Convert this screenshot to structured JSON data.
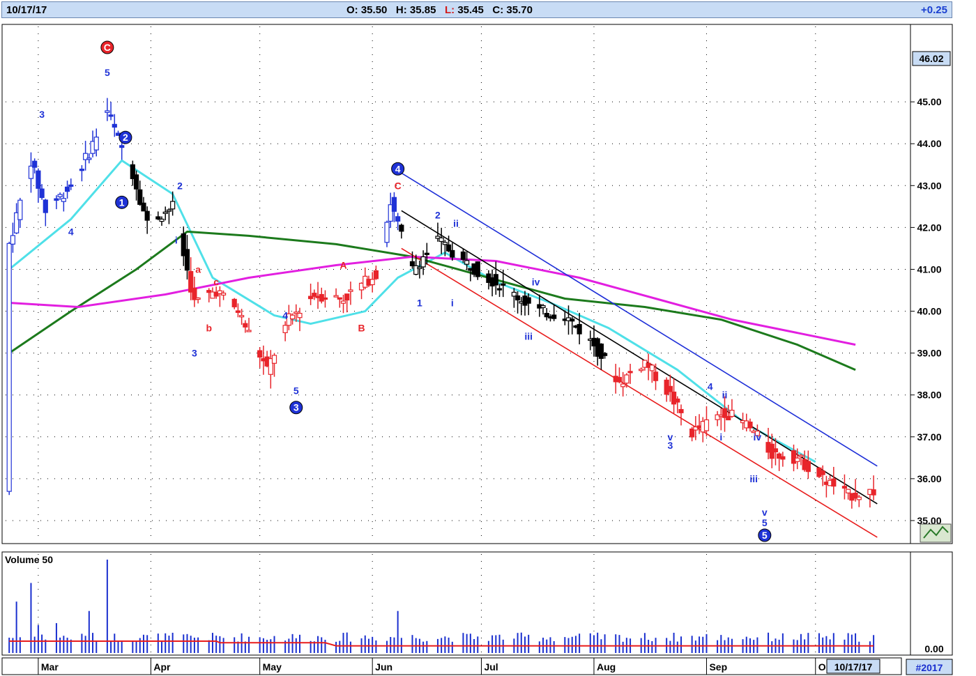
{
  "header": {
    "date": "10/17/17",
    "open_label": "O:",
    "open": "35.50",
    "high_label": "H:",
    "high": "35.85",
    "low_label": "L:",
    "low": "35.45",
    "close_label": "C:",
    "close": "35.70",
    "change": "+0.25"
  },
  "price_axis": {
    "last_price_box": "46.02",
    "ticks": [
      "45.00",
      "44.00",
      "43.00",
      "42.00",
      "41.00",
      "40.00",
      "39.00",
      "38.00",
      "37.00",
      "36.00",
      "35.00"
    ]
  },
  "volume_panel": {
    "title": "Volume 50",
    "tick": "0.00"
  },
  "time_axis": {
    "months": [
      "Mar",
      "Apr",
      "May",
      "Jun",
      "Jul",
      "Aug",
      "Sep",
      "O"
    ],
    "current_date_box": "10/17/17",
    "badge": "#2017"
  },
  "colors": {
    "up_wave": "#1f32d6",
    "down_wave": "#e8242a",
    "neutral": "#000000",
    "ma_short": "#4fe0e8",
    "ma_mid": "#1c7a1c",
    "ma_long": "#e21fe0",
    "channel_upper": "#1e2fd8",
    "channel_mid": "#000000",
    "channel_lower": "#e81c1c"
  },
  "chart_data": {
    "type": "candlestick",
    "title": "",
    "ylim": [
      34.5,
      46.8
    ],
    "months": [
      "Mar",
      "Apr",
      "May",
      "Jun",
      "Jul",
      "Aug",
      "Sep",
      "O"
    ],
    "price_path": [
      [
        "2017-02-21",
        41.6
      ],
      [
        "2017-02-27",
        43.6
      ],
      [
        "2017-03-03",
        42.4
      ],
      [
        "2017-03-10",
        43.0
      ],
      [
        "2017-03-15",
        43.8
      ],
      [
        "2017-03-20",
        44.8
      ],
      [
        "2017-03-23",
        44.1
      ],
      [
        "2017-03-27",
        43.3
      ],
      [
        "2017-03-31",
        42.1
      ],
      [
        "2017-04-07",
        42.5
      ],
      [
        "2017-04-13",
        40.2
      ],
      [
        "2017-04-19",
        40.5
      ],
      [
        "2017-04-25",
        40.0
      ],
      [
        "2017-05-03",
        38.6
      ],
      [
        "2017-05-09",
        39.8
      ],
      [
        "2017-05-16",
        40.4
      ],
      [
        "2017-05-24",
        40.3
      ],
      [
        "2017-06-02",
        40.9
      ],
      [
        "2017-06-06",
        42.6
      ],
      [
        "2017-06-12",
        41.0
      ],
      [
        "2017-06-19",
        41.7
      ],
      [
        "2017-06-26",
        41.2
      ],
      [
        "2017-07-03",
        40.8
      ],
      [
        "2017-07-10",
        40.4
      ],
      [
        "2017-07-17",
        40.0
      ],
      [
        "2017-07-24",
        39.9
      ],
      [
        "2017-08-01",
        39.2
      ],
      [
        "2017-08-08",
        38.3
      ],
      [
        "2017-08-15",
        38.8
      ],
      [
        "2017-08-22",
        38.0
      ],
      [
        "2017-08-28",
        37.1
      ],
      [
        "2017-09-06",
        37.6
      ],
      [
        "2017-09-12",
        37.3
      ],
      [
        "2017-09-19",
        36.6
      ],
      [
        "2017-09-26",
        36.5
      ],
      [
        "2017-10-03",
        36.0
      ],
      [
        "2017-10-10",
        35.6
      ],
      [
        "2017-10-17",
        35.7
      ]
    ],
    "last_bar": {
      "date": "10/17/17",
      "open": 35.5,
      "high": 35.85,
      "low": 35.45,
      "close": 35.7,
      "change": 0.25
    },
    "wave_labels": [
      {
        "text": "C",
        "date": "2017-03-20",
        "price": 46.3,
        "circled": true,
        "color": "red"
      },
      {
        "text": "5",
        "date": "2017-03-20",
        "price": 45.7,
        "color": "blue"
      },
      {
        "text": "3",
        "date": "2017-03-02",
        "price": 44.7,
        "color": "blue"
      },
      {
        "text": "4",
        "date": "2017-03-10",
        "price": 41.9,
        "color": "blue"
      },
      {
        "text": "2",
        "date": "2017-03-25",
        "price": 44.15,
        "circled": true,
        "color": "blue"
      },
      {
        "text": "1",
        "date": "2017-03-24",
        "price": 42.6,
        "circled": true,
        "color": "blue"
      },
      {
        "text": "2",
        "date": "2017-04-09",
        "price": 43.0,
        "color": "blue"
      },
      {
        "text": "i",
        "date": "2017-04-08",
        "price": 41.7,
        "color": "blue"
      },
      {
        "text": "a",
        "date": "2017-04-14",
        "price": 41.0,
        "color": "red"
      },
      {
        "text": "b",
        "date": "2017-04-17",
        "price": 39.6,
        "color": "red"
      },
      {
        "text": "c",
        "date": "2017-04-19",
        "price": 40.7,
        "color": "red"
      },
      {
        "text": "3",
        "date": "2017-04-13",
        "price": 39.0,
        "color": "blue"
      },
      {
        "text": "4",
        "date": "2017-05-08",
        "price": 39.9,
        "color": "blue"
      },
      {
        "text": "5",
        "date": "2017-05-11",
        "price": 38.1,
        "color": "blue"
      },
      {
        "text": "3",
        "date": "2017-05-11",
        "price": 37.7,
        "circled": true,
        "color": "blue"
      },
      {
        "text": "A",
        "date": "2017-05-24",
        "price": 41.1,
        "color": "red"
      },
      {
        "text": "B",
        "date": "2017-05-29",
        "price": 39.6,
        "color": "red"
      },
      {
        "text": "4",
        "date": "2017-06-08",
        "price": 43.4,
        "circled": true,
        "color": "blue"
      },
      {
        "text": "C",
        "date": "2017-06-08",
        "price": 43.0,
        "color": "red"
      },
      {
        "text": "2",
        "date": "2017-06-19",
        "price": 42.3,
        "color": "blue"
      },
      {
        "text": "1",
        "date": "2017-06-14",
        "price": 40.2,
        "color": "blue"
      },
      {
        "text": "ii",
        "date": "2017-06-24",
        "price": 42.1,
        "color": "blue"
      },
      {
        "text": "i",
        "date": "2017-06-23",
        "price": 40.2,
        "color": "blue"
      },
      {
        "text": "iv",
        "date": "2017-07-16",
        "price": 40.7,
        "color": "blue"
      },
      {
        "text": "iii",
        "date": "2017-07-14",
        "price": 39.4,
        "color": "blue"
      },
      {
        "text": "v",
        "date": "2017-08-22",
        "price": 37.0,
        "color": "blue"
      },
      {
        "text": "3",
        "date": "2017-08-22",
        "price": 36.8,
        "color": "blue"
      },
      {
        "text": "4",
        "date": "2017-09-02",
        "price": 38.2,
        "color": "blue"
      },
      {
        "text": "ii",
        "date": "2017-09-06",
        "price": 38.0,
        "color": "blue"
      },
      {
        "text": "i",
        "date": "2017-09-05",
        "price": 37.0,
        "color": "blue"
      },
      {
        "text": "iv",
        "date": "2017-09-15",
        "price": 37.0,
        "color": "blue"
      },
      {
        "text": "iii",
        "date": "2017-09-14",
        "price": 36.0,
        "color": "blue"
      },
      {
        "text": "v",
        "date": "2017-09-17",
        "price": 35.2,
        "color": "blue"
      },
      {
        "text": "5",
        "date": "2017-09-17",
        "price": 34.95,
        "color": "blue"
      },
      {
        "text": "5",
        "date": "2017-09-17",
        "price": 34.65,
        "circled": true,
        "color": "blue"
      }
    ],
    "moving_averages": [
      {
        "color": "#4fe0e8",
        "points": [
          [
            "2017-02-21",
            41.0
          ],
          [
            "2017-03-10",
            42.2
          ],
          [
            "2017-03-24",
            43.6
          ],
          [
            "2017-04-07",
            42.8
          ],
          [
            "2017-04-18",
            40.8
          ],
          [
            "2017-05-05",
            39.9
          ],
          [
            "2017-05-15",
            39.7
          ],
          [
            "2017-05-30",
            40.0
          ],
          [
            "2017-06-08",
            40.8
          ],
          [
            "2017-06-21",
            41.4
          ],
          [
            "2017-07-05",
            40.7
          ],
          [
            "2017-07-20",
            40.2
          ],
          [
            "2017-08-05",
            39.6
          ],
          [
            "2017-08-24",
            38.6
          ],
          [
            "2017-09-12",
            37.3
          ],
          [
            "2017-10-01",
            36.4
          ]
        ]
      },
      {
        "color": "#1c7a1c",
        "points": [
          [
            "2017-02-21",
            39.0
          ],
          [
            "2017-03-10",
            40.0
          ],
          [
            "2017-03-28",
            41.0
          ],
          [
            "2017-04-11",
            41.9
          ],
          [
            "2017-04-28",
            41.8
          ],
          [
            "2017-05-22",
            41.6
          ],
          [
            "2017-06-12",
            41.3
          ],
          [
            "2017-07-03",
            40.8
          ],
          [
            "2017-07-24",
            40.3
          ],
          [
            "2017-08-15",
            40.1
          ],
          [
            "2017-09-05",
            39.8
          ],
          [
            "2017-09-26",
            39.2
          ],
          [
            "2017-10-12",
            38.6
          ]
        ]
      },
      {
        "color": "#e21fe0",
        "points": [
          [
            "2017-02-21",
            40.2
          ],
          [
            "2017-03-12",
            40.1
          ],
          [
            "2017-04-05",
            40.4
          ],
          [
            "2017-04-28",
            40.8
          ],
          [
            "2017-05-22",
            41.1
          ],
          [
            "2017-06-12",
            41.3
          ],
          [
            "2017-07-05",
            41.2
          ],
          [
            "2017-07-28",
            40.8
          ],
          [
            "2017-08-18",
            40.3
          ],
          [
            "2017-09-08",
            39.8
          ],
          [
            "2017-10-12",
            39.2
          ]
        ]
      }
    ],
    "channel": [
      {
        "color": "#1e2fd8",
        "from": [
          "2017-06-09",
          43.3
        ],
        "to": [
          "2017-10-18",
          36.3
        ]
      },
      {
        "color": "#000000",
        "from": [
          "2017-06-09",
          42.4
        ],
        "to": [
          "2017-10-18",
          35.4
        ]
      },
      {
        "color": "#e81c1c",
        "from": [
          "2017-06-09",
          41.5
        ],
        "to": [
          "2017-10-18",
          34.6
        ]
      }
    ],
    "volume_axis_tick": 0.0
  }
}
